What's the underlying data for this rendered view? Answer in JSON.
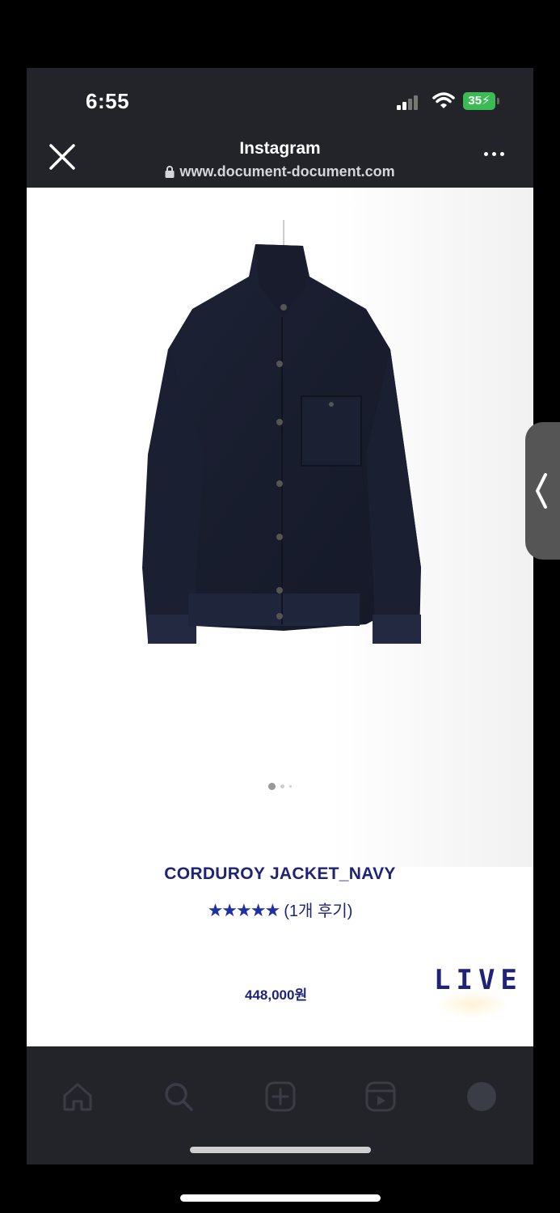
{
  "status_bar": {
    "time": "6:55",
    "battery": "35"
  },
  "browser": {
    "title": "Instagram",
    "url": "www.document-document.com"
  },
  "product": {
    "image_description_icon": "jacket-photo",
    "carousel": {
      "count": 3,
      "active_index": 0
    },
    "name": "CORDUROY JACKET_NAVY",
    "stars": "★★★★★",
    "review_text": "(1개 후기)",
    "price": "448,000원",
    "live_badge": "LIVE"
  },
  "colors": {
    "brand_navy": "#1f2378",
    "bar_bg": "#22242a",
    "battery_green": "#3cba54"
  }
}
